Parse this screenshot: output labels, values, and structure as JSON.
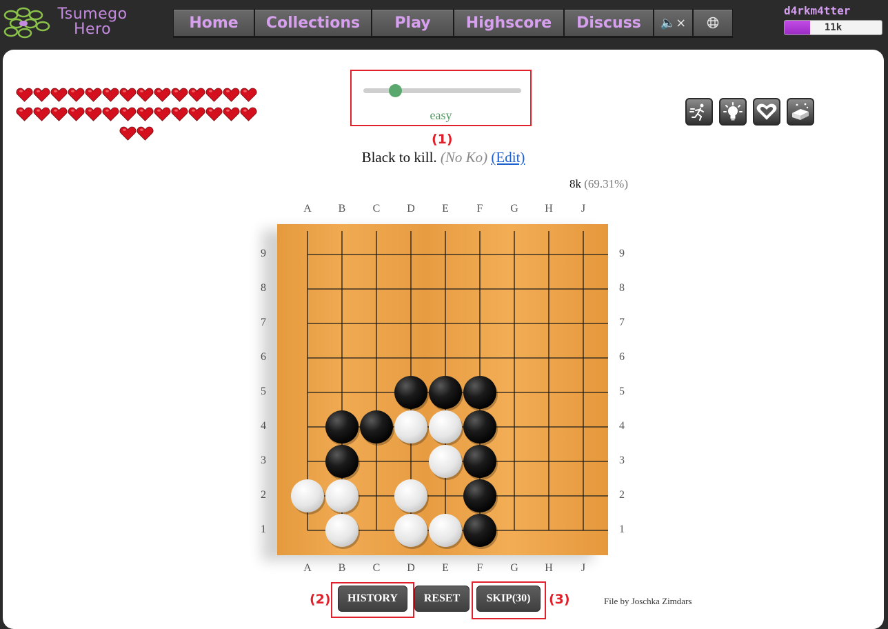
{
  "header": {
    "logo_line1": "Tsumego",
    "logo_line2": "Hero",
    "nav": [
      {
        "label": "Home",
        "icon": null
      },
      {
        "label": "Collections",
        "icon": null
      },
      {
        "label": "Play",
        "icon": null
      },
      {
        "label": "Highscore",
        "icon": null
      },
      {
        "label": "Discuss",
        "icon": null
      },
      {
        "label": "🔈×",
        "icon": "mute-icon"
      },
      {
        "label": "",
        "icon": "board-grid-icon"
      }
    ],
    "user": {
      "name": "d4rkm4tter",
      "rank": "11k",
      "rank_progress": 0.26
    }
  },
  "hearts": {
    "count": 30,
    "color": "#d4101e"
  },
  "difficulty": {
    "label": "easy",
    "level": 0.2,
    "color": "#5aa86e"
  },
  "annotations": {
    "mark1": "(1)",
    "mark2": "(2)",
    "mark3": "(3)"
  },
  "tools": [
    "sprint-icon",
    "hint-lightbulb-icon",
    "heart-icon",
    "rejuvenation-eraser-icon"
  ],
  "problem": {
    "description": "Black to kill.",
    "ko_note": "(No Ko)",
    "edit_link": "(Edit)",
    "rank": "8k",
    "percent": "(69.31%)"
  },
  "board": {
    "columns": [
      "A",
      "B",
      "C",
      "D",
      "E",
      "F",
      "G",
      "H",
      "J"
    ],
    "rows": [
      "9",
      "8",
      "7",
      "6",
      "5",
      "4",
      "3",
      "2",
      "1"
    ],
    "black": [
      "D5",
      "E5",
      "F5",
      "B4",
      "C4",
      "F4",
      "B3",
      "F3",
      "F2",
      "F1"
    ],
    "white": [
      "D4",
      "E4",
      "E3",
      "A2",
      "B2",
      "D2",
      "B1",
      "D1",
      "E1"
    ]
  },
  "buttons": {
    "history": "HISTORY",
    "reset": "RESET",
    "skip": "SKIP(30)"
  },
  "credit": "File by Joschka Zimdars"
}
